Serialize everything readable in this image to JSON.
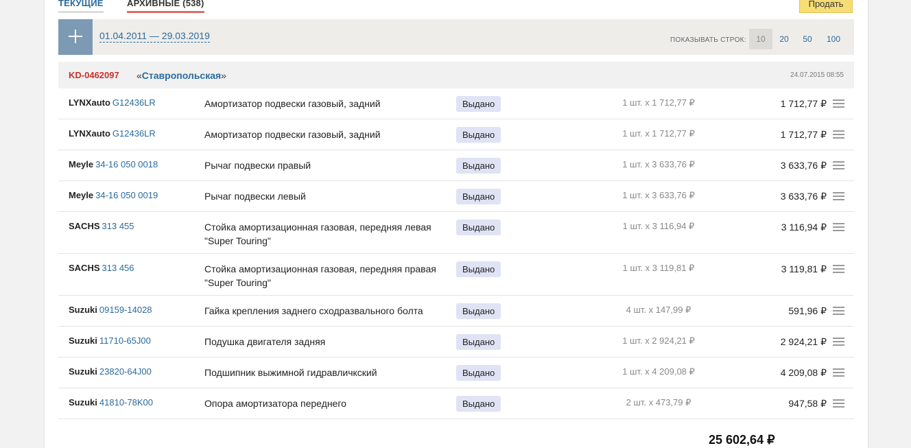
{
  "tabs": {
    "current": "ТЕКУЩИЕ",
    "archive": "АРХИВНЫЕ (538)"
  },
  "sell_button": "Продать",
  "filter": {
    "date_range": "01.04.2011 — 29.03.2019",
    "rows_label": "ПОКАЗЫВАТЬ СТРОК:",
    "rows_options": [
      "10",
      "20",
      "50",
      "100"
    ],
    "rows_selected": "10"
  },
  "order": {
    "id": "KD-0462097",
    "store_open": "«",
    "store": "Ставропольская",
    "store_close": "»",
    "date": "24.07.2015 08:55"
  },
  "items": [
    {
      "brand": "LYNXauto",
      "code": "G12436LR",
      "desc": "Амортизатор подвески газовый, задний",
      "status": "Выдано",
      "qty": "1 шт. x 1 712,77 ₽",
      "sum": "1 712,77 ₽"
    },
    {
      "brand": "LYNXauto",
      "code": "G12436LR",
      "desc": "Амортизатор подвески газовый, задний",
      "status": "Выдано",
      "qty": "1 шт. x 1 712,77 ₽",
      "sum": "1 712,77 ₽"
    },
    {
      "brand": "Meyle",
      "code": "34-16 050 0018",
      "desc": "Рычаг подвески правый",
      "status": "Выдано",
      "qty": "1 шт. x 3 633,76 ₽",
      "sum": "3 633,76 ₽"
    },
    {
      "brand": "Meyle",
      "code": "34-16 050 0019",
      "desc": "Рычаг подвески левый",
      "status": "Выдано",
      "qty": "1 шт. x 3 633,76 ₽",
      "sum": "3 633,76 ₽"
    },
    {
      "brand": "SACHS",
      "code": "313 455",
      "desc": "Стойка амортизационная газовая, передняя левая \"Super Touring\"",
      "status": "Выдано",
      "qty": "1 шт. x 3 116,94 ₽",
      "sum": "3 116,94 ₽"
    },
    {
      "brand": "SACHS",
      "code": "313 456",
      "desc": "Стойка амортизационная газовая, передняя правая \"Super Touring\"",
      "status": "Выдано",
      "qty": "1 шт. x 3 119,81 ₽",
      "sum": "3 119,81 ₽"
    },
    {
      "brand": "Suzuki",
      "code": "09159-14028",
      "desc": "Гайка крепления заднего сходразвального болта",
      "status": "Выдано",
      "qty": "4 шт. x 147,99 ₽",
      "sum": "591,96 ₽"
    },
    {
      "brand": "Suzuki",
      "code": "11710-65J00",
      "desc": "Подушка двигателя задняя",
      "status": "Выдано",
      "qty": "1 шт. x 2 924,21 ₽",
      "sum": "2 924,21 ₽"
    },
    {
      "brand": "Suzuki",
      "code": "23820-64J00",
      "desc": "Подшипник выжимной гидравличкский",
      "status": "Выдано",
      "qty": "1 шт. x 4 209,08 ₽",
      "sum": "4 209,08 ₽"
    },
    {
      "brand": "Suzuki",
      "code": "41810-78K00",
      "desc": "Опора амортизатора переднего",
      "status": "Выдано",
      "qty": "2 шт. x 473,79 ₽",
      "sum": "947,58 ₽"
    }
  ],
  "total": "25 602,64 ₽",
  "icons": {
    "add": "plus-icon",
    "row_menu": "menu-icon"
  },
  "colors": {
    "accent_link": "#2a6a9c",
    "order_id": "#c9302c",
    "sell_button": "#f6dd74",
    "status_badge": "#dfe3f4",
    "add_button": "#7d9ab4"
  }
}
